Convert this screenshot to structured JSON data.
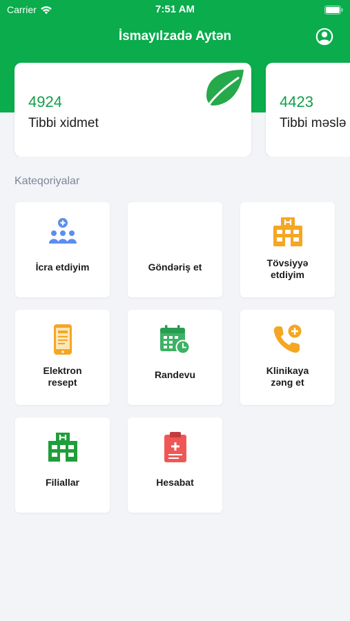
{
  "status_bar": {
    "carrier": "Carrier",
    "time": "7:51 AM"
  },
  "header": {
    "title": "İsmayılzadə Aytən"
  },
  "stats": [
    {
      "value": "4924",
      "label": "Tibbi xidmet"
    },
    {
      "value": "4423",
      "label": "Tibbi məslə"
    }
  ],
  "categories_title": "Kateqoriyalar",
  "tiles": [
    {
      "label": "İcra etdiyim",
      "icon": "people-icon"
    },
    {
      "label": "Göndəriş et",
      "icon": ""
    },
    {
      "label": "Tövsiyyə\netdiyim",
      "icon": "hospital-building-icon"
    },
    {
      "label": "Elektron\nresept",
      "icon": "phone-prescription-icon"
    },
    {
      "label": "Randevu",
      "icon": "calendar-clock-icon"
    },
    {
      "label": "Klinikaya\nzəng et",
      "icon": "phone-call-icon"
    },
    {
      "label": "Filiallar",
      "icon": "hospital-branch-icon"
    },
    {
      "label": "Hesabat",
      "icon": "clipboard-report-icon"
    }
  ],
  "colors": {
    "brand_green": "#0aac4c",
    "accent_orange": "#f5a623",
    "report_red": "#ef5757"
  }
}
